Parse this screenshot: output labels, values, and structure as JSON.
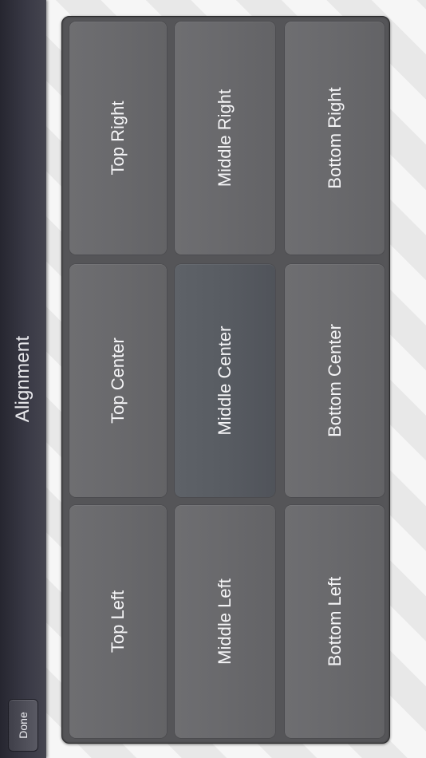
{
  "navbar": {
    "title": "Alignment",
    "done_label": "Done"
  },
  "alignment_grid": {
    "selected": "Middle Center",
    "cells": {
      "top_right": "Top Right",
      "middle_right": "Middle Right",
      "bottom_right": "Bottom Right",
      "top_center": "Top Center",
      "middle_center": "Middle Center",
      "bottom_center": "Bottom Center",
      "top_left": "Top Left",
      "middle_left": "Middle Left",
      "bottom_left": "Bottom Left"
    }
  },
  "colors": {
    "navbar": "#3a3a46",
    "cell": "#69696c",
    "cell_selected": "#585c62",
    "panel": "#555558"
  }
}
